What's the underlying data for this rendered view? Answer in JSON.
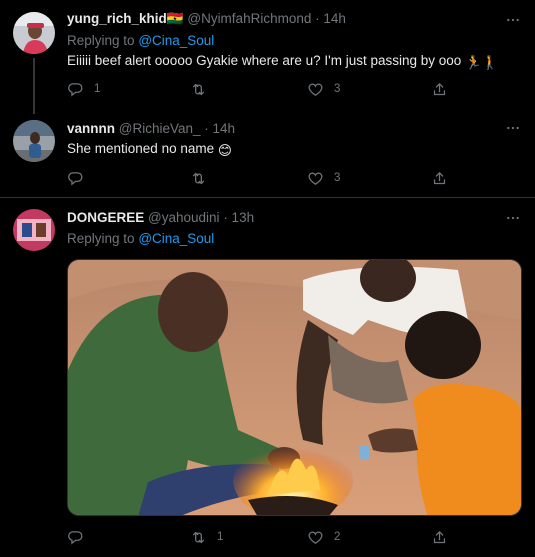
{
  "tweets": [
    {
      "name": "yung_rich_khid",
      "flag": "🇬🇭",
      "handle": "@NyimfahRichmond",
      "time": "· 14h",
      "replying_prefix": "Replying to",
      "replying_to": "@Cina_Soul",
      "text": "Eiiiii beef alert ooooo Gyakie where are u? I'm just passing by ooo",
      "emoji_suffix": "🏃🚶",
      "replies": "1",
      "retweets": "",
      "likes": "3"
    },
    {
      "name": "vannnn",
      "handle": "@RichieVan_",
      "time": "· 14h",
      "text": "She mentioned no name",
      "emoji_suffix": "😊",
      "replies": "",
      "retweets": "",
      "likes": "3"
    },
    {
      "name": "DONGEREE",
      "handle": "@yahoudini",
      "time": "· 13h",
      "replying_prefix": "Replying to",
      "replying_to": "@Cina_Soul",
      "replies": "",
      "retweets": "1",
      "likes": "2"
    }
  ],
  "icons": {
    "reply": "reply-icon",
    "retweet": "retweet-icon",
    "like": "heart-icon",
    "share": "share-icon",
    "more": "more-icon"
  },
  "colors": {
    "background": "#000000",
    "link": "#1d9bf0",
    "muted": "#71767b",
    "text": "#e7e9ea"
  }
}
